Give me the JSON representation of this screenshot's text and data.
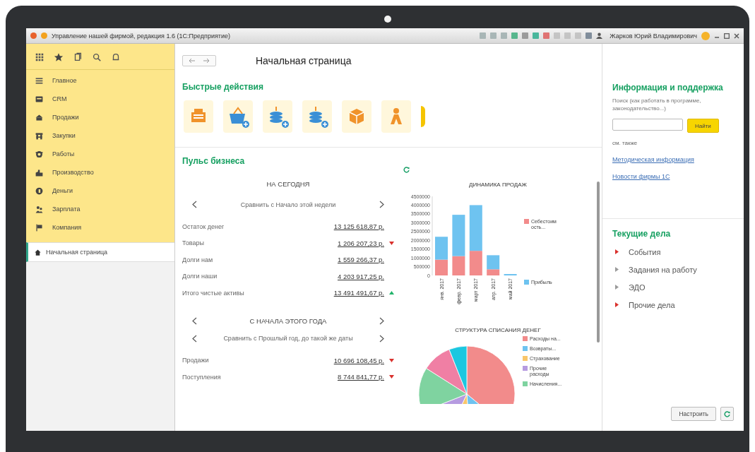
{
  "window": {
    "title": "Управление нашей фирмой, редакция 1.6 (1С:Предприятие)",
    "user": "Жарков Юрий Владимирович"
  },
  "sidebar": {
    "items": [
      {
        "label": "Главное"
      },
      {
        "label": "CRM"
      },
      {
        "label": "Продажи"
      },
      {
        "label": "Закупки"
      },
      {
        "label": "Работы"
      },
      {
        "label": "Производство"
      },
      {
        "label": "Деньги"
      },
      {
        "label": "Зарплата"
      },
      {
        "label": "Компания"
      }
    ],
    "open_pages": [
      {
        "label": "Начальная страница",
        "selected": true
      }
    ]
  },
  "page": {
    "title": "Начальная страница"
  },
  "quick_actions": {
    "title": "Быстрые действия",
    "items": [
      {
        "kind": "register"
      },
      {
        "kind": "basket-add"
      },
      {
        "kind": "coins-in"
      },
      {
        "kind": "coins-out"
      },
      {
        "kind": "box"
      },
      {
        "kind": "worker"
      }
    ]
  },
  "pulse": {
    "title": "Пульс бизнеса",
    "today": {
      "heading": "НА СЕГОДНЯ",
      "compare": "Сравнить с Начало этой недели",
      "rows": [
        {
          "name": "Остаток денег",
          "value": "13 125 618,87 р.",
          "kind": "plain"
        },
        {
          "name": "Товары",
          "value": "1 206 207,23 р.",
          "kind": "down"
        },
        {
          "name": "Долги нам",
          "value": "1 559 266,37 р.",
          "kind": "plain"
        },
        {
          "name": "Долги наши",
          "value": "4 203 917,25 р.",
          "kind": "plain"
        },
        {
          "name": "Итого чистые активы",
          "value": "13 491 491,67 р.",
          "kind": "up"
        }
      ]
    },
    "year": {
      "heading": "С НАЧАЛА ЭТОГО ГОДА",
      "compare": "Сравнить с Прошлый год, до такой же даты",
      "rows": [
        {
          "name": "Продажи",
          "value": "10 696 108,45 р.",
          "kind": "down"
        },
        {
          "name": "Поступления",
          "value": "8 744 841,77 р.",
          "kind": "down"
        }
      ]
    },
    "sales_chart": {
      "chart_data": {
        "type": "bar",
        "title": "ДИНАМИКА ПРОДАЖ",
        "stacked": true,
        "categories": [
          "янв. 2017",
          "февр. 2017",
          "март 2017",
          "апр. 2017",
          "май 2017"
        ],
        "series": [
          {
            "name": "Себестоим ость...",
            "color": "#f28b8b",
            "values": [
              900000,
              1100000,
              1400000,
              350000,
              0
            ]
          },
          {
            "name": "Прибыль",
            "color": "#6ec3f0",
            "values": [
              1300000,
              2350000,
              2600000,
              800000,
              80000
            ]
          }
        ],
        "ylim": [
          0,
          4500000
        ],
        "yticks": [
          0,
          500000,
          1000000,
          1500000,
          2000000,
          2500000,
          3000000,
          3500000,
          4000000,
          4500000
        ]
      }
    },
    "spending": {
      "title": "СТРУКТУРА СПИСАНИЯ ДЕНЕГ",
      "legend": [
        {
          "label": "Расходы на...",
          "color": "#f28b8b"
        },
        {
          "label": "Возвраты...",
          "color": "#6ec3f0"
        },
        {
          "label": "Страхование",
          "color": "#f9c66a"
        },
        {
          "label": "Прочие расходы",
          "color": "#b69be0"
        },
        {
          "label": "Начисления...",
          "color": "#7fd3a0"
        }
      ]
    }
  },
  "support": {
    "title": "Информация и поддержка",
    "hint": "Поиск (как работать в программе, законодательство...)",
    "search_button": "Найти",
    "see_also": "см. также",
    "links": [
      "Методическая информация",
      "Новости фирмы 1С"
    ]
  },
  "tasks": {
    "title": "Текущие дела",
    "items": [
      {
        "label": "События",
        "color": "#d9302c"
      },
      {
        "label": "Задания на работу",
        "color": "#9a9a9a"
      },
      {
        "label": "ЭДО",
        "color": "#9a9a9a"
      },
      {
        "label": "Прочие дела",
        "color": "#d9302c"
      }
    ],
    "settings_button": "Настроить"
  }
}
